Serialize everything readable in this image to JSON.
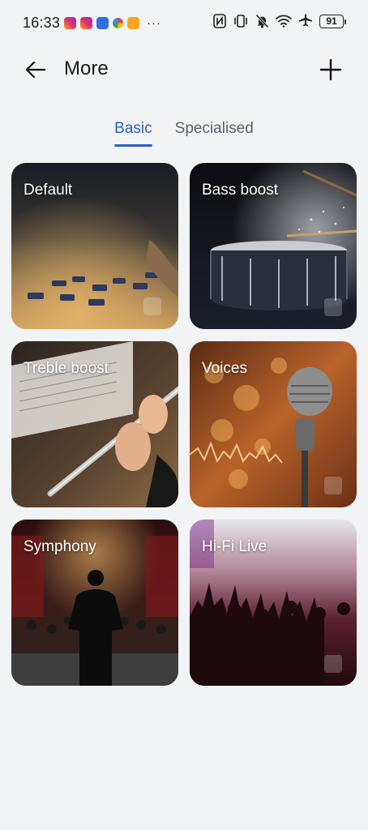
{
  "status_bar": {
    "time": "16:33",
    "dots": "···",
    "battery": "91",
    "notification_icons": [
      "instagram-icon",
      "instagram-icon",
      "blue-app-icon",
      "photos-icon",
      "orange-app-icon"
    ],
    "system_icons": [
      "nfc-icon",
      "vibrate-icon",
      "bell-off-icon",
      "wifi-icon",
      "airplane-icon",
      "battery-icon"
    ]
  },
  "header": {
    "title": "More",
    "back_icon": "arrow-left-icon",
    "add_icon": "plus-icon"
  },
  "tabs": [
    {
      "label": "Basic",
      "active": true
    },
    {
      "label": "Specialised",
      "active": false
    }
  ],
  "colors": {
    "accent": "#2b5fc6",
    "background": "#f1f3f5"
  },
  "presets": [
    {
      "label": "Default"
    },
    {
      "label": "Bass boost"
    },
    {
      "label": "Treble boost"
    },
    {
      "label": "Voices"
    },
    {
      "label": "Symphony"
    },
    {
      "label": "Hi-Fi Live"
    }
  ]
}
